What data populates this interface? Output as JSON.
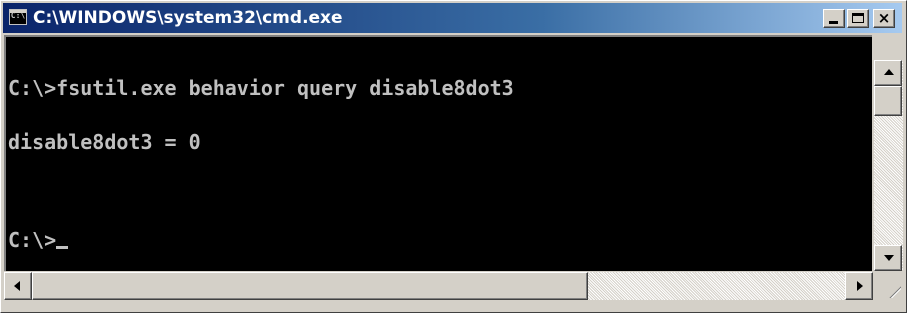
{
  "window": {
    "title": "C:\\WINDOWS\\system32\\cmd.exe",
    "icon": "cmd-icon",
    "icon_label": "C:\\"
  },
  "title_buttons": {
    "minimize": "minimize-icon",
    "maximize": "maximize-icon",
    "close": "×"
  },
  "console": {
    "lines": [
      "C:\\>fsutil.exe behavior query disable8dot3",
      "disable8dot3 = 0",
      "",
      "C:\\>"
    ],
    "background": "#000000",
    "foreground": "#c0c0c0"
  },
  "colors": {
    "titlebar_start": "#0a246a",
    "titlebar_end": "#a6caf0",
    "chrome": "#d4d0c8"
  }
}
